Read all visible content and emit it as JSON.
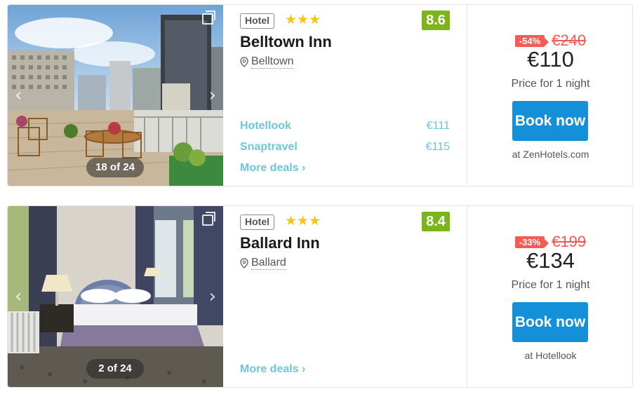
{
  "hotels": [
    {
      "type": "Hotel",
      "stars": "★★★",
      "rating": "8.6",
      "name": "Belltown Inn",
      "location": "Belltown",
      "photo_counter": "18 of 24",
      "deals": [
        {
          "provider": "Hotellook",
          "price": "€111"
        },
        {
          "provider": "Snaptravel",
          "price": "€115"
        }
      ],
      "more_deals": "More deals ›",
      "discount": "-54%",
      "old_price": "€240",
      "price": "€110",
      "price_note": "Price for 1 night",
      "book_label": "Book now",
      "booking_site": "at ZenHotels.com"
    },
    {
      "type": "Hotel",
      "stars": "★★★",
      "rating": "8.4",
      "name": "Ballard Inn",
      "location": "Ballard",
      "photo_counter": "2 of 24",
      "deals": [],
      "more_deals": "More deals ›",
      "discount": "-33%",
      "old_price": "€199",
      "price": "€134",
      "price_note": "Price for 1 night",
      "book_label": "Book now",
      "booking_site": "at Hotellook"
    }
  ],
  "colors": {
    "rating_bg": "#7cb518",
    "book_button": "#1490d8",
    "discount": "#f25c54",
    "deal_link": "#6ec6d8",
    "star": "#f5c518"
  }
}
